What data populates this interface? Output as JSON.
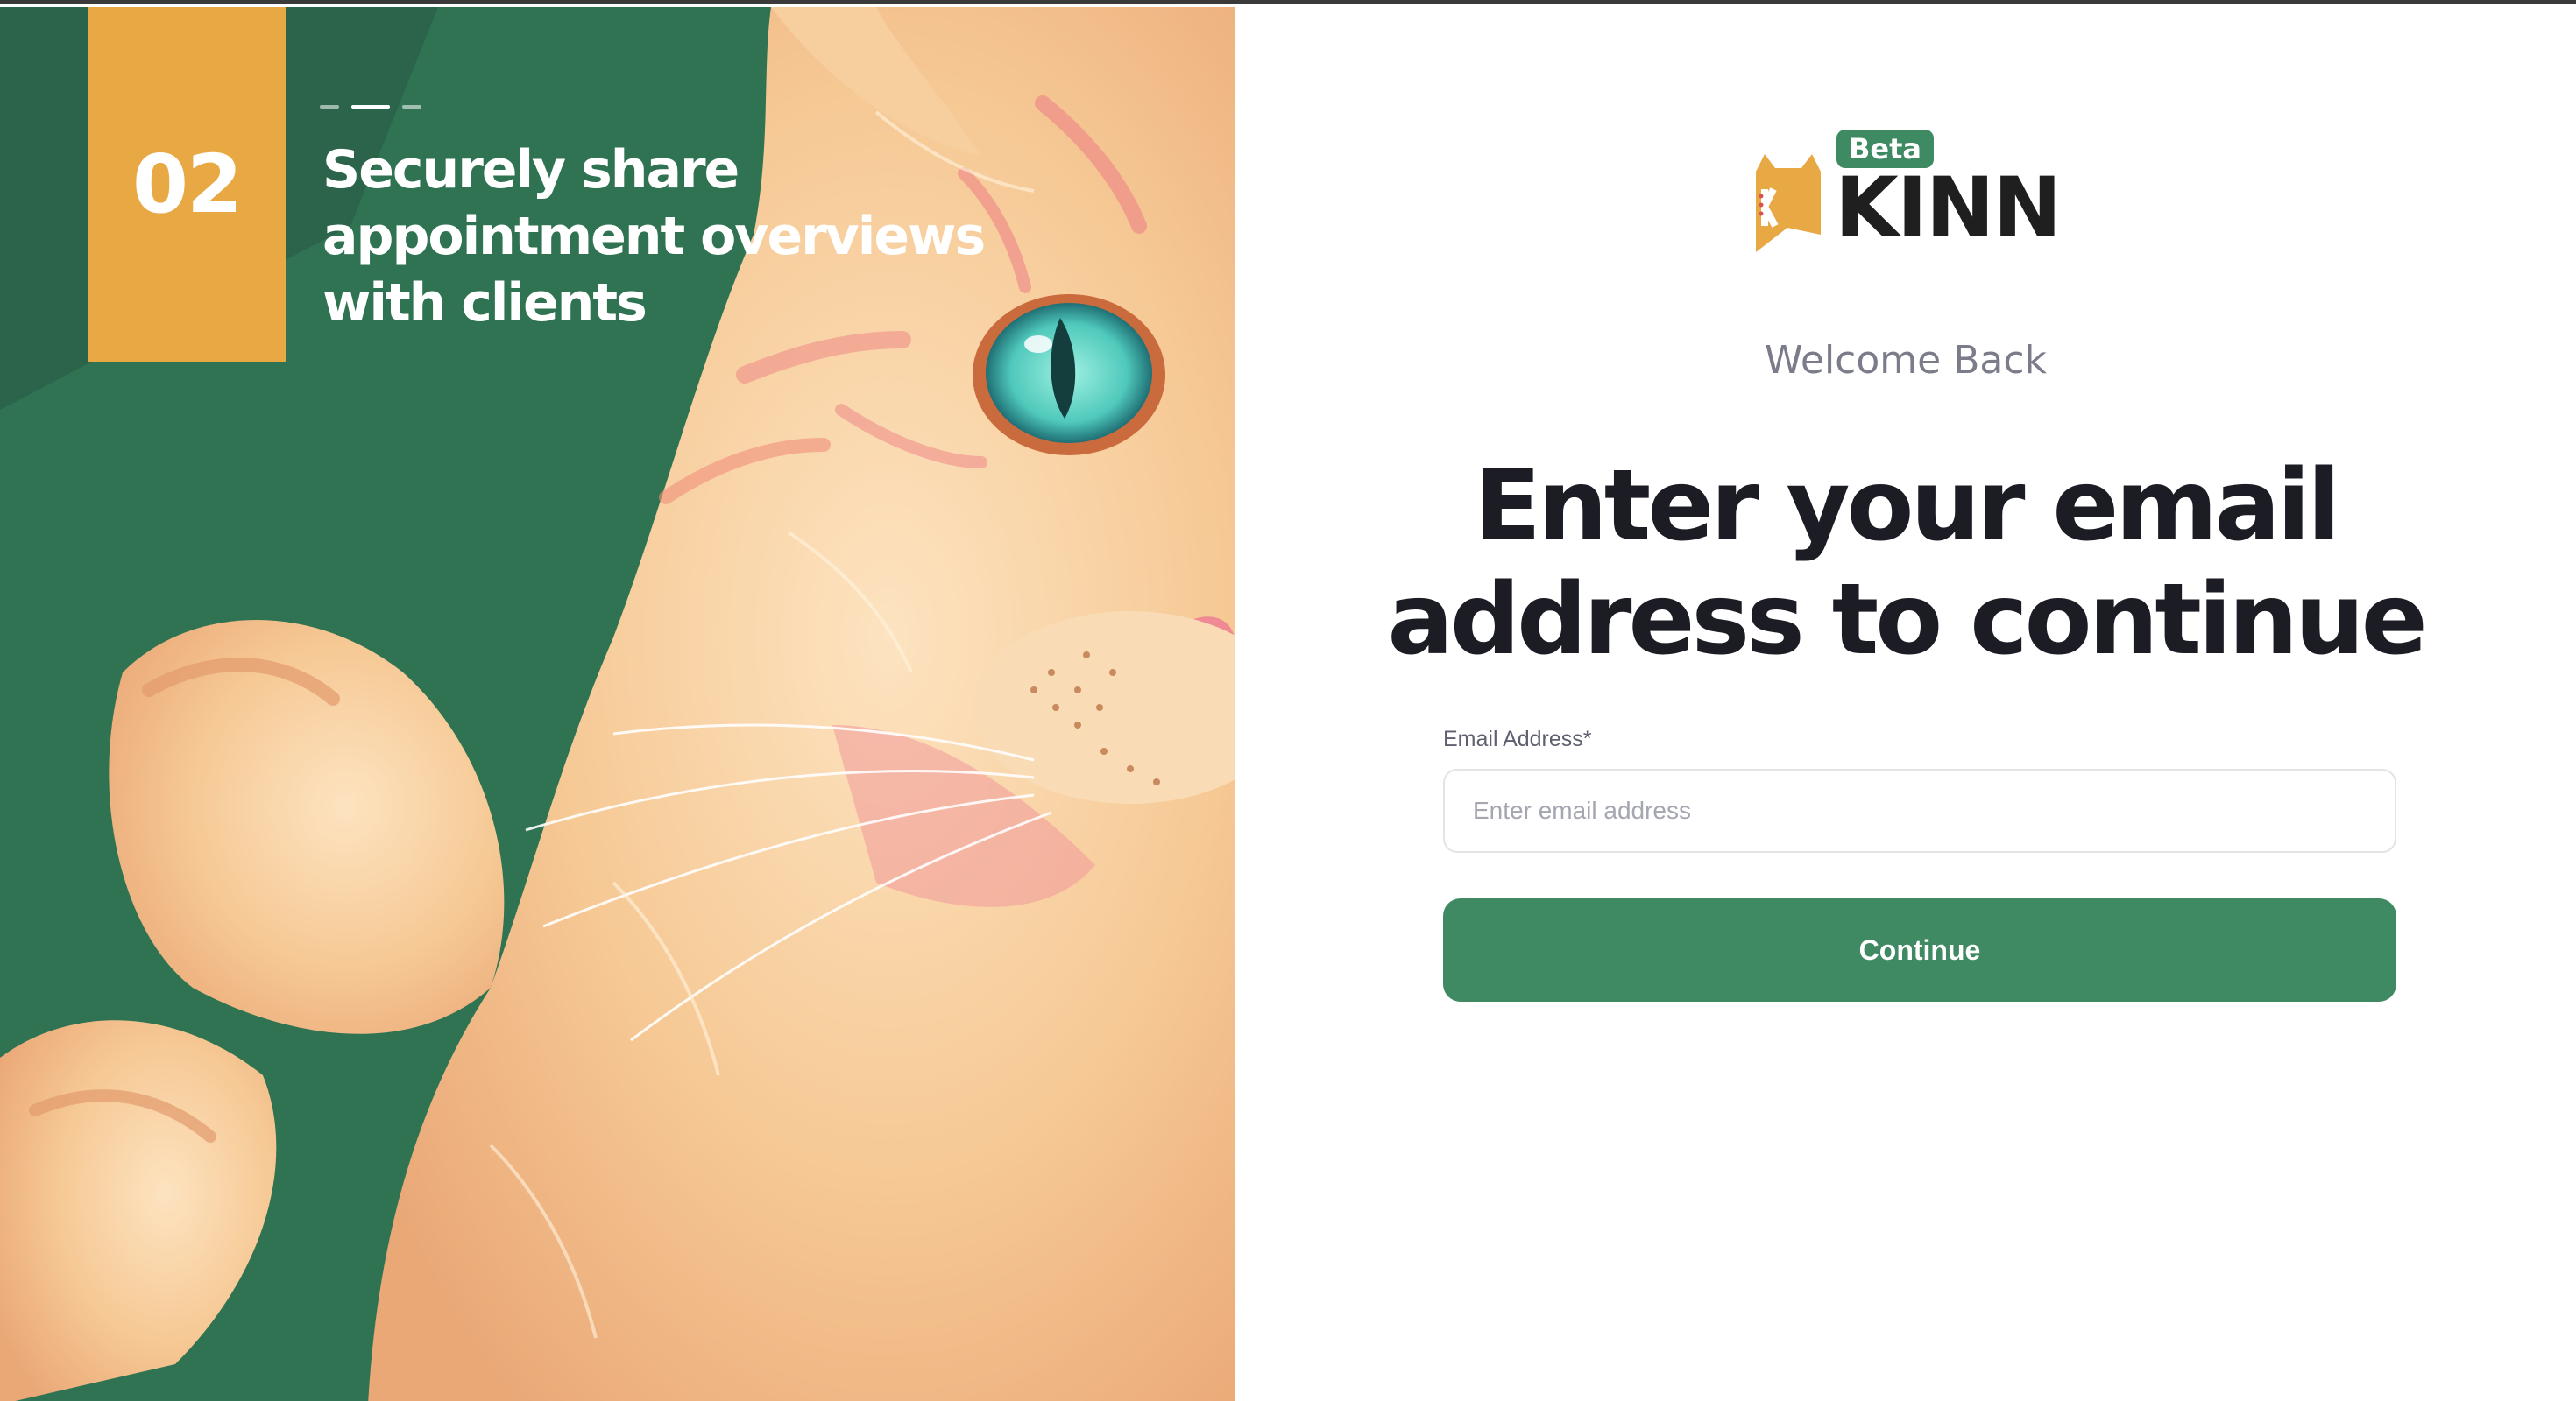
{
  "onboarding": {
    "step_number": "02",
    "caption": "Securely share appointment overviews with clients",
    "pager": {
      "total": 3,
      "active_index": 1
    }
  },
  "brand": {
    "name": "KINN",
    "badge_letter": "K",
    "beta_label": "Beta",
    "colors": {
      "primary": "#3f8a63",
      "accent": "#e8a945"
    }
  },
  "login": {
    "welcome": "Welcome Back",
    "headline": "Enter your email address to continue",
    "email_label": "Email Address*",
    "email_placeholder": "Enter email address",
    "email_value": "",
    "continue_label": "Continue"
  }
}
